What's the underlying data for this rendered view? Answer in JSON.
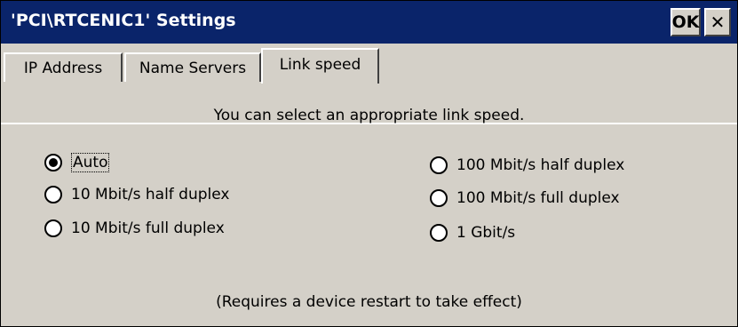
{
  "window": {
    "title": "'PCI\\RTCENIC1' Settings",
    "ok_label": "OK",
    "close_label": "✕"
  },
  "tabs": [
    {
      "label": "IP Address",
      "selected": false
    },
    {
      "label": "Name Servers",
      "selected": false
    },
    {
      "label": "Link speed",
      "selected": true
    }
  ],
  "content": {
    "intro": "You can select an appropriate link speed.",
    "note": "(Requires a device restart to take effect)"
  },
  "options": [
    {
      "label": "Auto",
      "checked": true
    },
    {
      "label": "10 Mbit/s half duplex",
      "checked": false
    },
    {
      "label": "10 Mbit/s full duplex",
      "checked": false
    },
    {
      "label": "100 Mbit/s half duplex",
      "checked": false
    },
    {
      "label": "100 Mbit/s full duplex",
      "checked": false
    },
    {
      "label": "1 Gbit/s",
      "checked": false
    }
  ],
  "colors": {
    "titlebar": "#0a246a",
    "face": "#d4d0c8"
  }
}
